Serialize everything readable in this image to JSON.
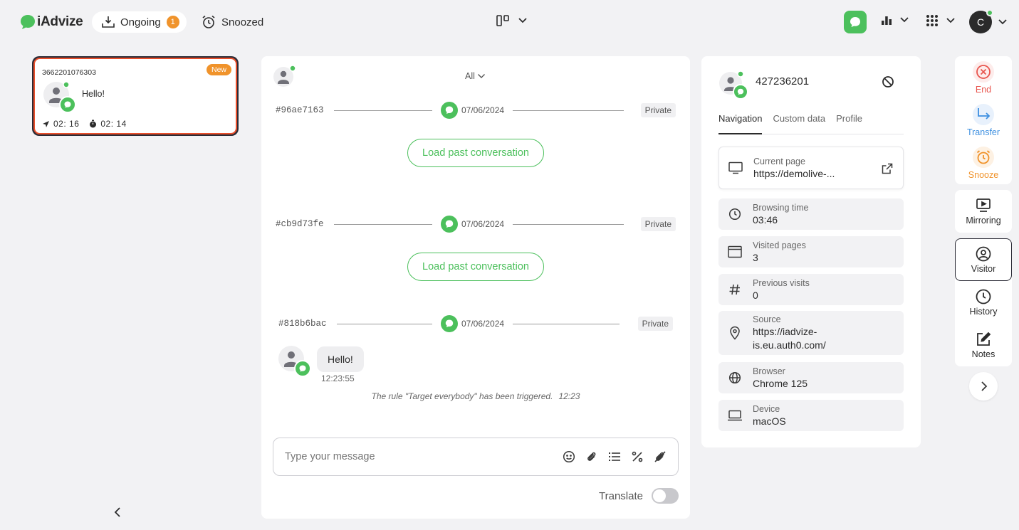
{
  "app": {
    "brand": "iAdvize"
  },
  "topbar": {
    "ongoing_label": "Ongoing",
    "ongoing_count": "1",
    "snoozed_label": "Snoozed",
    "avatar_initial": "C"
  },
  "conversation_card": {
    "id": "3662201076303",
    "badge": "New",
    "last_message": "Hello!",
    "time_sent": "02: 16",
    "time_wait": "02: 14"
  },
  "chat": {
    "filter_label": "All",
    "segments": [
      {
        "id": "#96ae7163",
        "date": "07/06/2024",
        "tag": "Private",
        "load_label": "Load past conversation"
      },
      {
        "id": "#cb9d73fe",
        "date": "07/06/2024",
        "tag": "Private",
        "load_label": "Load past conversation"
      },
      {
        "id": "#818b6bac",
        "date": "07/06/2024",
        "tag": "Private"
      }
    ],
    "message": {
      "text": "Hello!",
      "time": "12:23:55"
    },
    "rule_text": "The rule \"Target everybody\" has been triggered.",
    "rule_time": "12:23",
    "composer_placeholder": "Type your message",
    "translate_label": "Translate"
  },
  "visitor": {
    "id": "427236201",
    "tabs": [
      "Navigation",
      "Custom data",
      "Profile"
    ],
    "cards": {
      "current_page": {
        "label": "Current page",
        "value": "https://demolive-..."
      },
      "browsing_time": {
        "label": "Browsing time",
        "value": "03:46"
      },
      "visited_pages": {
        "label": "Visited pages",
        "value": "3"
      },
      "previous_visits": {
        "label": "Previous visits",
        "value": "0"
      },
      "source": {
        "label": "Source",
        "value_line1": "https://iadvize-",
        "value_line2": "is.eu.auth0.com/"
      },
      "browser": {
        "label": "Browser",
        "value": "Chrome 125"
      },
      "device": {
        "label": "Device",
        "value": "macOS"
      }
    }
  },
  "rail": {
    "end_label": "End",
    "transfer_label": "Transfer",
    "snooze_label": "Snooze",
    "mirroring_label": "Mirroring",
    "visitor_label": "Visitor",
    "history_label": "History",
    "notes_label": "Notes"
  },
  "colors": {
    "accent_green": "#4cc05c",
    "badge_orange": "#f0932b",
    "end_red": "#e8554e",
    "transfer_blue": "#3d8fe0",
    "snooze_orange": "#f0932b",
    "selected_border": "#e94f2b"
  }
}
